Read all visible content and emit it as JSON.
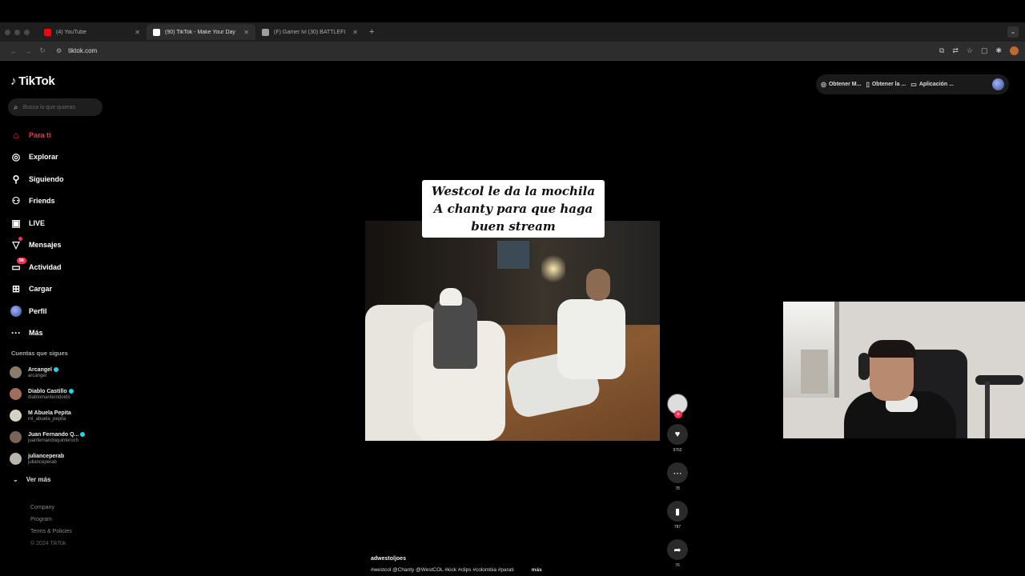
{
  "browser": {
    "tabs": [
      {
        "title": "(4) YouTube",
        "favicon_color": "#ff0000",
        "active": false
      },
      {
        "title": "(90) TikTok - Make Your Day",
        "favicon_color": "#ffffff",
        "active": true
      },
      {
        "title": "(F) Gamer lvl (30) BATTLEFI",
        "favicon_color": "#9aa0a6",
        "active": false
      }
    ],
    "url": "tiktok.com"
  },
  "tiktok": {
    "logo": "TikTok",
    "search_placeholder": "Busca lo que quieras",
    "nav": [
      {
        "label": "Para ti",
        "icon": "home-icon",
        "active": true
      },
      {
        "label": "Explorar",
        "icon": "compass-icon"
      },
      {
        "label": "Siguiendo",
        "icon": "user-follow-icon"
      },
      {
        "label": "Friends",
        "icon": "friends-icon"
      },
      {
        "label": "LIVE",
        "icon": "live-icon"
      },
      {
        "label": "Mensajes",
        "icon": "send-icon",
        "badge_dot": true
      },
      {
        "label": "Actividad",
        "icon": "inbox-icon",
        "badge": "99"
      },
      {
        "label": "Cargar",
        "icon": "upload-icon"
      },
      {
        "label": "Perfil",
        "icon": "profile-avatar"
      },
      {
        "label": "Más",
        "icon": "more-icon"
      }
    ],
    "following_title": "Cuentas que sigues",
    "following": [
      {
        "name": "Arcangel",
        "handle": "arcangel",
        "verified": true
      },
      {
        "name": "Diablo Castillo",
        "handle": "diablomanterodoido",
        "verified": true
      },
      {
        "name": "M Abuela Pepita",
        "handle": "mi_abuela_pepita",
        "verified": false
      },
      {
        "name": "Juan Fernando Q...",
        "handle": "juanfernandoquinteroch",
        "verified": true
      },
      {
        "name": "julianceperab",
        "handle": "julianceperab",
        "verified": false
      }
    ],
    "see_more": "Ver más",
    "footer": [
      "Company",
      "Program",
      "Terms & Policies",
      "© 2024 TikTok"
    ],
    "top_pills": [
      "Obtener M...",
      "Obtener la ...",
      "Aplicación ..."
    ]
  },
  "video": {
    "caption_lines": [
      "Westcol le da la mochila",
      "A chanty para que haga",
      "buen stream"
    ],
    "username": "adwestoljoes",
    "description": "#westcol @Chanty @WestCOL #kick #clips #colombia #parati",
    "more_label": "más",
    "counts": {
      "likes": "9762",
      "comments": "78",
      "saves": "787",
      "shares": "76"
    }
  }
}
